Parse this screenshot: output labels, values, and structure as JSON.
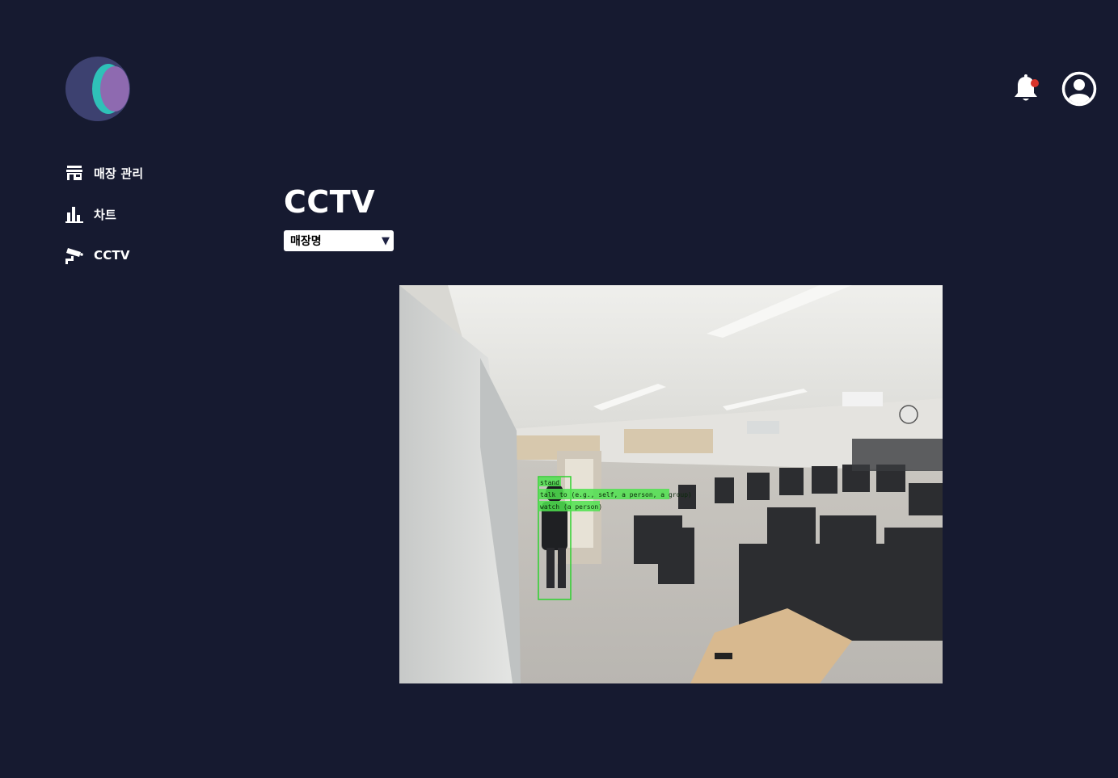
{
  "sidebar": {
    "items": [
      {
        "label": "매장 관리",
        "icon": "store-icon"
      },
      {
        "label": "차트",
        "icon": "bar-chart-icon"
      },
      {
        "label": "CCTV",
        "icon": "cctv-camera-icon"
      }
    ]
  },
  "header": {
    "notification_icon": "bell-icon",
    "notification_badge_color": "#d9342b",
    "profile_icon": "user-circle-icon"
  },
  "main": {
    "title": "CCTV",
    "store_select": {
      "value": "매장명",
      "icon": "caret-down-icon"
    },
    "feed": {
      "detections": [
        {
          "label": "stand"
        },
        {
          "label": "talk to (e.g., self, a person, a group)"
        },
        {
          "label": "watch (a person)"
        }
      ]
    }
  },
  "colors": {
    "background": "#161a30",
    "text": "#ffffff",
    "detection_box": "#2ed12e",
    "logo_dark": "#3d4170",
    "logo_teal": "#2fc1b8",
    "logo_purple": "#8e6ab0"
  }
}
